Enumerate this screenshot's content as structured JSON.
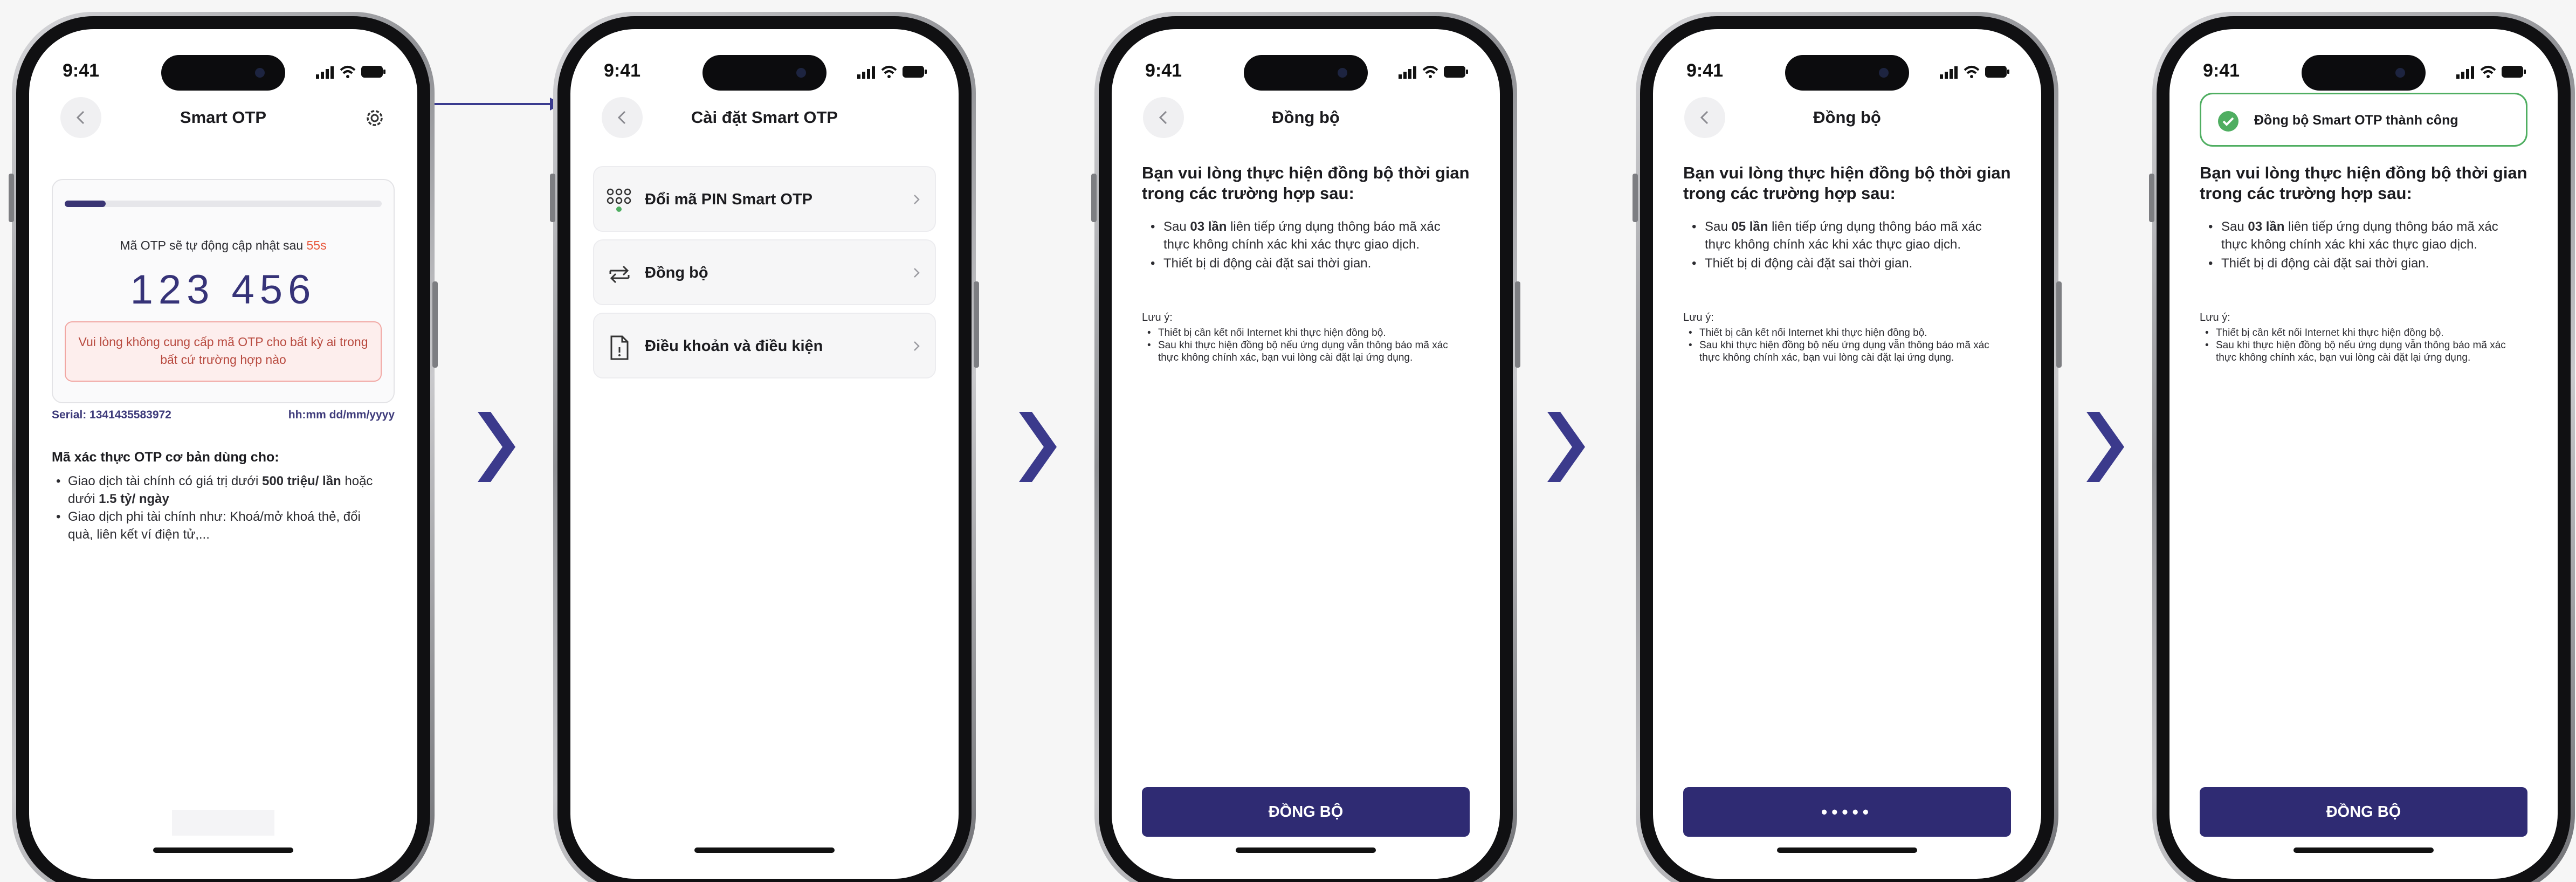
{
  "status": {
    "time": "9:41"
  },
  "colors": {
    "primary": "#2f2b73",
    "accent": "#3a3574",
    "warning": "#e8573b",
    "success": "#4fae61"
  },
  "screen1": {
    "title": "Smart OTP",
    "progress": 0.13,
    "caption_prefix": "Mã OTP sẽ tự động cập nhật sau ",
    "countdown": "55s",
    "otp_code": "123 456",
    "warning": "Vui lòng không cung cấp mã OTP cho bất kỳ ai trong bất cứ trường hợp nào",
    "serial": "Serial: 1341435583972",
    "time_format": "hh:mm dd/mm/yyyy",
    "uses_title": "Mã xác thực OTP cơ bản dùng cho:",
    "uses": {
      "item1_pre": "Giao dịch tài chính có giá trị dưới ",
      "item1_b1": "500 triệu/ lần",
      "item1_mid": " hoặc dưới ",
      "item1_b2": "1.5 tỷ/ ngày",
      "item2": "Giao dịch phi tài chính như: Khoá/mở khoá thẻ, đổi quà, liên kết ví điện tử,..."
    }
  },
  "screen2": {
    "title": "Cài đặt Smart OTP",
    "items": [
      {
        "label": "Đổi mã PIN Smart OTP",
        "icon": "keypad-icon"
      },
      {
        "label": "Đồng bộ",
        "icon": "sync-icon"
      },
      {
        "label": "Điều khoản và điều kiện",
        "icon": "document-icon"
      }
    ]
  },
  "sync": {
    "title": "Đồng bộ",
    "heading": "Bạn vui lòng thực hiện đồng bộ thời gian trong các trường hợp sau:",
    "item1_pre": "Sau ",
    "item1_count_a": "03 lần",
    "item1_count_b": "05 lần",
    "item1_post": " liên tiếp ứng dụng thông báo mã xác thực không chính xác khi xác thực giao dịch.",
    "item2": "Thiết bị di động cài đặt sai thời gian.",
    "note_title": "Lưu ý:",
    "note1": "Thiết bị cần kết nối Internet khi thực hiện đồng bộ.",
    "note2": "Sau khi thực hiện đồng bộ nếu ứng dụng vẫn thông báo mã xác thực không chính xác, bạn vui lòng cài đặt lại ứng dụng.",
    "button": "ĐỒNG BỘ",
    "loading_dots": "•••••",
    "success_toast": "Đồng bộ Smart OTP thành công"
  }
}
